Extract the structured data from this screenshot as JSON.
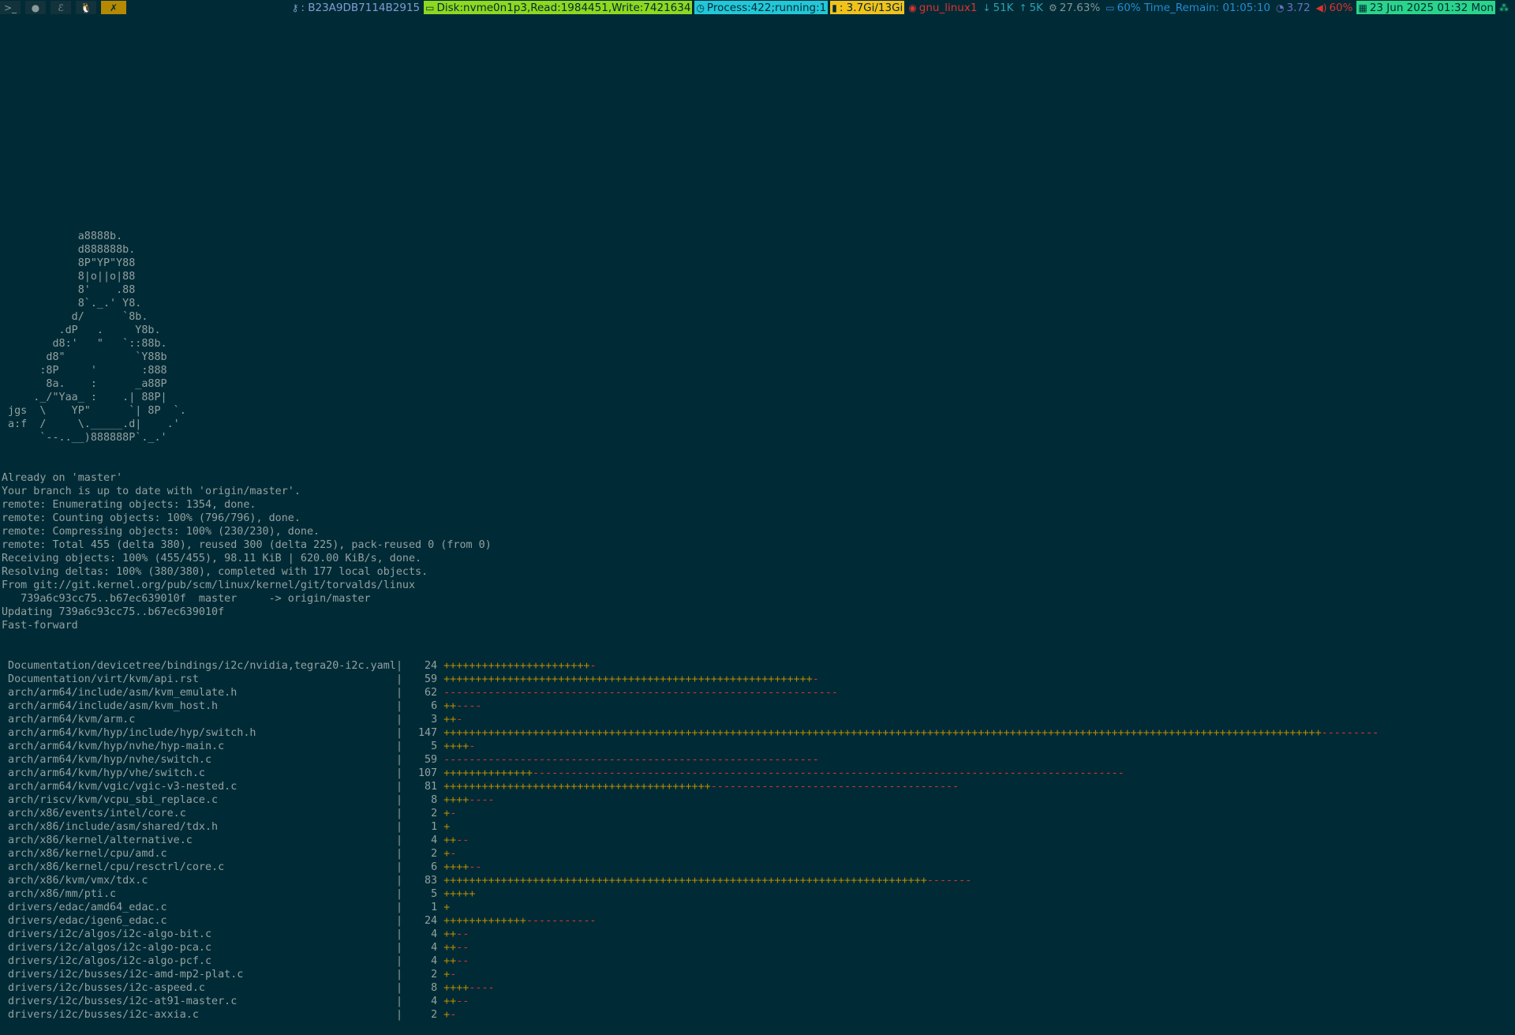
{
  "topbar": {
    "workspaces": [
      {
        "icon": "terminal-icon",
        "glyph": ">_",
        "active": false
      },
      {
        "icon": "firefox-icon",
        "glyph": "●",
        "active": false
      },
      {
        "icon": "emacs-icon",
        "glyph": "ℰ",
        "active": false
      },
      {
        "icon": "linux-icon",
        "glyph": "🐧",
        "active": false
      },
      {
        "icon": "tools-icon",
        "glyph": "✗",
        "active": true
      }
    ],
    "status": [
      {
        "name": "key-segment",
        "icon": "key-icon",
        "glyph": "⚷",
        "text": ": B23A9DB7114B2915",
        "fg": "#839cd5",
        "bg": "transparent"
      },
      {
        "name": "disk-segment",
        "icon": "disk-icon",
        "glyph": "▭",
        "text": "Disk:nvme0n1p3,Read:1984451,Write:7421634",
        "fg": "#002b36",
        "bg": "#8ed81f"
      },
      {
        "name": "process-segment",
        "icon": "process-icon",
        "glyph": "◷",
        "text": "Process:422;running:1",
        "fg": "#002b36",
        "bg": "#22c7d8"
      },
      {
        "name": "memory-segment",
        "icon": "memory-icon",
        "glyph": "▮",
        "text": ": 3.7Gi/13Gi",
        "fg": "#002b36",
        "bg": "#f2c21b"
      },
      {
        "name": "wifi-segment",
        "icon": "wifi-icon",
        "glyph": "◉",
        "text": "gnu_linux1",
        "fg": "#dc322f",
        "bg": "transparent"
      },
      {
        "name": "download-segment",
        "icon": "download-icon",
        "glyph": "↓",
        "text": "51K",
        "fg": "#2aa1b3",
        "bg": "transparent"
      },
      {
        "name": "upload-segment",
        "icon": "upload-icon",
        "glyph": "↑",
        "text": "5K",
        "fg": "#2aa1b3",
        "bg": "transparent"
      },
      {
        "name": "cpu-segment",
        "icon": "gear-icon",
        "glyph": "⚙",
        "text": "27.63%",
        "fg": "#839496",
        "bg": "transparent"
      },
      {
        "name": "battery-segment",
        "icon": "battery-icon",
        "glyph": "▭",
        "text": "60% Time_Remain: 01:05:10",
        "fg": "#268bd2",
        "bg": "transparent"
      },
      {
        "name": "load-segment",
        "icon": "dashboard-icon",
        "glyph": "◔",
        "text": "3.72",
        "fg": "#6c71c4",
        "bg": "transparent"
      },
      {
        "name": "volume-segment",
        "icon": "volume-icon",
        "glyph": "◀)",
        "text": "60%",
        "fg": "#dc322f",
        "bg": "transparent"
      },
      {
        "name": "date-segment",
        "icon": "calendar-icon",
        "glyph": "▦",
        "text": "23 Jun 2025 01:32 Mon",
        "fg": "#002b36",
        "bg": "#2ad48a"
      },
      {
        "name": "tray-segment",
        "icon": "network-tray-icon",
        "glyph": "⁂",
        "text": "",
        "fg": "#2ad48a",
        "bg": "transparent"
      }
    ]
  },
  "terminal": {
    "ascii_art": [
      "            a8888b.",
      "            d888888b.",
      "            8P\"YP\"Y88",
      "            8|o||o|88",
      "            8'    .88",
      "            8`._.' Y8.",
      "           d/      `8b.",
      "         .dP   .     Y8b.",
      "        d8:'   \"   `::88b.",
      "       d8\"           `Y88b",
      "      :8P     '       :888",
      "       8a.    :      _a88P",
      "     ._/\"Yaa_ :    .| 88P|",
      " jgs  \\    YP\"      `| 8P  `.",
      " a:f  /     \\._____.d|    .'",
      "      `--..__)888888P`._.'"
    ],
    "messages": [
      "Already on 'master'",
      "Your branch is up to date with 'origin/master'.",
      "remote: Enumerating objects: 1354, done.",
      "remote: Counting objects: 100% (796/796), done.",
      "remote: Compressing objects: 100% (230/230), done.",
      "remote: Total 455 (delta 380), reused 300 (delta 225), pack-reused 0 (from 0)",
      "Receiving objects: 100% (455/455), 98.11 KiB | 620.00 KiB/s, done.",
      "Resolving deltas: 100% (380/380), completed with 177 local objects.",
      "From git://git.kernel.org/pub/scm/linux/kernel/git/torvalds/linux",
      "   739a6c93cc75..b67ec639010f  master     -> origin/master",
      "Updating 739a6c93cc75..b67ec639010f",
      "Fast-forward"
    ],
    "diffstat": [
      {
        "file": "Documentation/devicetree/bindings/i2c/nvidia,tegra20-i2c.yaml",
        "count": "24",
        "plus": 23,
        "minus": 1
      },
      {
        "file": "Documentation/virt/kvm/api.rst",
        "count": "59",
        "plus": 58,
        "minus": 1
      },
      {
        "file": "arch/arm64/include/asm/kvm_emulate.h",
        "count": "62",
        "plus": 0,
        "minus": 62
      },
      {
        "file": "arch/arm64/include/asm/kvm_host.h",
        "count": "6",
        "plus": 2,
        "minus": 4
      },
      {
        "file": "arch/arm64/kvm/arm.c",
        "count": "3",
        "plus": 2,
        "minus": 1
      },
      {
        "file": "arch/arm64/kvm/hyp/include/hyp/switch.h",
        "count": "147",
        "plus": 138,
        "minus": 9
      },
      {
        "file": "arch/arm64/kvm/hyp/nvhe/hyp-main.c",
        "count": "5",
        "plus": 4,
        "minus": 1
      },
      {
        "file": "arch/arm64/kvm/hyp/nvhe/switch.c",
        "count": "59",
        "plus": 0,
        "minus": 59
      },
      {
        "file": "arch/arm64/kvm/hyp/vhe/switch.c",
        "count": "107",
        "plus": 14,
        "minus": 93
      },
      {
        "file": "arch/arm64/kvm/vgic/vgic-v3-nested.c",
        "count": "81",
        "plus": 42,
        "minus": 39
      },
      {
        "file": "arch/riscv/kvm/vcpu_sbi_replace.c",
        "count": "8",
        "plus": 4,
        "minus": 4
      },
      {
        "file": "arch/x86/events/intel/core.c",
        "count": "2",
        "plus": 1,
        "minus": 1
      },
      {
        "file": "arch/x86/include/asm/shared/tdx.h",
        "count": "1",
        "plus": 1,
        "minus": 0
      },
      {
        "file": "arch/x86/kernel/alternative.c",
        "count": "4",
        "plus": 2,
        "minus": 2
      },
      {
        "file": "arch/x86/kernel/cpu/amd.c",
        "count": "2",
        "plus": 1,
        "minus": 1
      },
      {
        "file": "arch/x86/kernel/cpu/resctrl/core.c",
        "count": "6",
        "plus": 4,
        "minus": 2
      },
      {
        "file": "arch/x86/kvm/vmx/tdx.c",
        "count": "83",
        "plus": 76,
        "minus": 7
      },
      {
        "file": "arch/x86/mm/pti.c",
        "count": "5",
        "plus": 5,
        "minus": 0
      },
      {
        "file": "drivers/edac/amd64_edac.c",
        "count": "1",
        "plus": 1,
        "minus": 0
      },
      {
        "file": "drivers/edac/igen6_edac.c",
        "count": "24",
        "plus": 13,
        "minus": 11
      },
      {
        "file": "drivers/i2c/algos/i2c-algo-bit.c",
        "count": "4",
        "plus": 2,
        "minus": 2
      },
      {
        "file": "drivers/i2c/algos/i2c-algo-pca.c",
        "count": "4",
        "plus": 2,
        "minus": 2
      },
      {
        "file": "drivers/i2c/algos/i2c-algo-pcf.c",
        "count": "4",
        "plus": 2,
        "minus": 2
      },
      {
        "file": "drivers/i2c/busses/i2c-amd-mp2-plat.c",
        "count": "2",
        "plus": 1,
        "minus": 1
      },
      {
        "file": "drivers/i2c/busses/i2c-aspeed.c",
        "count": "8",
        "plus": 4,
        "minus": 4
      },
      {
        "file": "drivers/i2c/busses/i2c-at91-master.c",
        "count": "4",
        "plus": 2,
        "minus": 2
      },
      {
        "file": "drivers/i2c/busses/i2c-axxia.c",
        "count": "2",
        "plus": 1,
        "minus": 1
      }
    ]
  }
}
